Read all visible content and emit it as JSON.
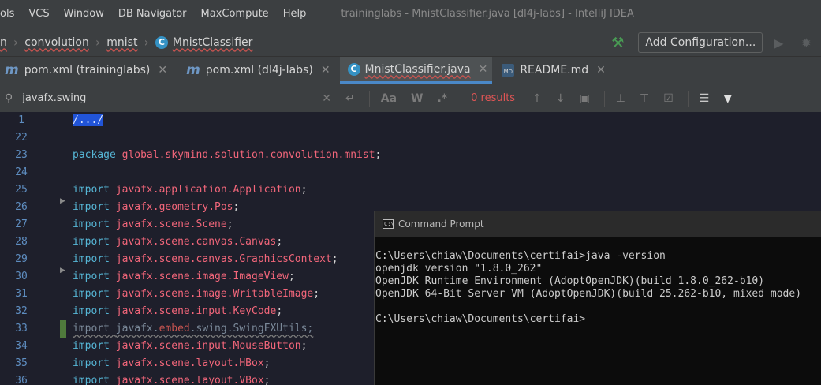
{
  "menu": {
    "items": [
      "ols",
      "VCS",
      "Window",
      "DB Navigator",
      "MaxCompute",
      "Help"
    ],
    "window_title": "traininglabs - MnistClassifier.java [dl4j-labs] - IntelliJ IDEA"
  },
  "breadcrumb": {
    "items": [
      "n",
      "convolution",
      "mnist",
      "MnistClassifier"
    ]
  },
  "toolbar": {
    "add_config_label": "Add Configuration..."
  },
  "tabs": [
    {
      "label": "pom.xml (traininglabs)",
      "icon": "maven-icon",
      "active": false
    },
    {
      "label": "pom.xml (dl4j-labs)",
      "icon": "maven-icon",
      "active": false
    },
    {
      "label": "MnistClassifier.java",
      "icon": "java-class-icon",
      "active": true
    },
    {
      "label": "README.md",
      "icon": "markdown-icon",
      "active": false
    }
  ],
  "search": {
    "value": "javafx.swing",
    "results": "0 results",
    "case_label": "Aa",
    "word_label": "W",
    "regex_label": ".*"
  },
  "editor": {
    "lines": [
      {
        "num": "1",
        "kind": "fold",
        "text": "/.../"
      },
      {
        "num": "22",
        "kind": "blank",
        "text": ""
      },
      {
        "num": "23",
        "kind": "package",
        "kw": "package",
        "name": "global.skymind.solution.convolution.mnist",
        "end": ";"
      },
      {
        "num": "24",
        "kind": "blank",
        "text": ""
      },
      {
        "num": "25",
        "kind": "import",
        "kw": "import",
        "pkg": "javafx.application.",
        "cls": "Application"
      },
      {
        "num": "26",
        "kind": "import",
        "kw": "import",
        "pkg": "javafx.geometry.",
        "cls": "Pos"
      },
      {
        "num": "27",
        "kind": "import",
        "kw": "import",
        "pkg": "javafx.scene.",
        "cls": "Scene"
      },
      {
        "num": "28",
        "kind": "import",
        "kw": "import",
        "pkg": "javafx.scene.canvas.",
        "cls": "Canvas"
      },
      {
        "num": "29",
        "kind": "import",
        "kw": "import",
        "pkg": "javafx.scene.canvas.",
        "cls": "GraphicsContext"
      },
      {
        "num": "30",
        "kind": "import",
        "kw": "import",
        "pkg": "javafx.scene.image.",
        "cls": "ImageView"
      },
      {
        "num": "31",
        "kind": "import",
        "kw": "import",
        "pkg": "javafx.scene.image.",
        "cls": "WritableImage"
      },
      {
        "num": "32",
        "kind": "import",
        "kw": "import",
        "pkg": "javafx.scene.input.",
        "cls": "KeyCode"
      },
      {
        "num": "33",
        "kind": "unused",
        "kw": "import",
        "pre": "javafx.",
        "err": "embed",
        "post": ".swing.SwingFXUtils;"
      },
      {
        "num": "34",
        "kind": "import",
        "kw": "import",
        "pkg": "javafx.scene.input.",
        "cls": "MouseButton"
      },
      {
        "num": "35",
        "kind": "import",
        "kw": "import",
        "pkg": "javafx.scene.layout.",
        "cls": "HBox"
      },
      {
        "num": "36",
        "kind": "import",
        "kw": "import",
        "pkg": "javafx.scene.layout.",
        "cls": "VBox"
      }
    ]
  },
  "cmd": {
    "title": "Command Prompt",
    "icon_text": "C:\\",
    "lines": [
      "C:\\Users\\chiaw\\Documents\\certifai>java -version",
      "openjdk version \"1.8.0_262\"",
      "OpenJDK Runtime Environment (AdoptOpenJDK)(build 1.8.0_262-b10)",
      "OpenJDK 64-Bit Server VM (AdoptOpenJDK)(build 25.262-b10, mixed mode)",
      "",
      "C:\\Users\\chiaw\\Documents\\certifai>"
    ]
  }
}
